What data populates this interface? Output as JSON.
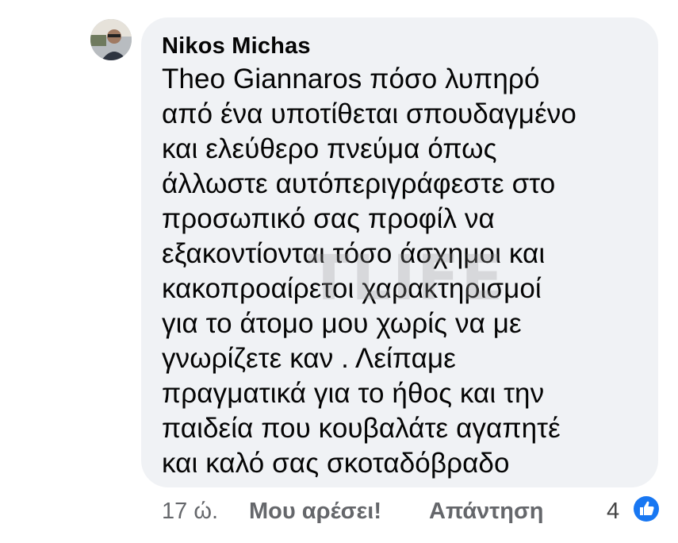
{
  "comment": {
    "author": "Nikos Michas",
    "mention": "Theo Giannaros",
    "lines": [
      " πόσο λυπηρό",
      "από ένα υποτίθεται σπουδαγμένο",
      "και ελεύθερο πνεύμα όπως",
      "άλλωστε αυτόπεριγράφεστε στο",
      "προσωπικό σας προφίλ  να",
      "εξακοντίονται τόσο άσχημοι και",
      "κακοπροαίρετοι χαρακτηρισμοί",
      "για το άτομο μου χωρίς να με",
      "γνωρίζετε καν . Λείπαμε",
      "πραγματικά για το ήθος και την",
      "παιδεία που κουβαλάτε αγαπητέ",
      "και καλό σας σκοταδόβραδο"
    ]
  },
  "watermark": "TLIFE",
  "actions": {
    "time": "17 ώ.",
    "like_label": "Μου αρέσει!",
    "reply_label": "Απάντηση",
    "reaction_count": "4"
  },
  "icons": {
    "reaction": "thumbs-up-icon"
  },
  "colors": {
    "bubble": "#f0f2f5",
    "action_text": "#65676b",
    "like_blue": "#1877f2"
  }
}
